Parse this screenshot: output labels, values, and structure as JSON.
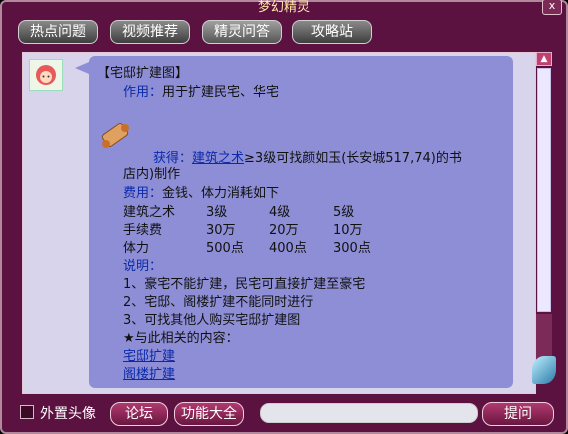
{
  "window": {
    "title": "梦幻精灵",
    "close_label": "x"
  },
  "tabs": [
    {
      "label": "热点问题"
    },
    {
      "label": "视频推荐"
    },
    {
      "label": "精灵问答"
    },
    {
      "label": "攻略站"
    }
  ],
  "answer": {
    "heading": "【宅邸扩建图】",
    "usage_label": "作用：",
    "usage_text": "用于扩建民宅、华宅",
    "obtain_label": "获得：",
    "obtain_link": "建筑之术",
    "obtain_text": "≥3级可找颜如玉(长安城517,74)的书",
    "obtain_text2": "店内)制作",
    "cost_label": "费用：",
    "cost_text": "金钱、体力消耗如下",
    "table": {
      "rows": [
        [
          "建筑之术",
          "3级",
          "4级",
          "5级"
        ],
        [
          "手续费",
          "30万",
          "20万",
          "10万"
        ],
        [
          "体力",
          "500点",
          "400点",
          "300点"
        ]
      ]
    },
    "notes_label": "说明：",
    "notes": [
      "1、豪宅不能扩建，民宅可直接扩建至豪宅",
      "2、宅邸、阁楼扩建不能同时进行",
      "3、可找其他人购买宅邸扩建图"
    ],
    "related_label": "★与此相关的内容：",
    "related_links": [
      "宅邸扩建",
      "阁楼扩建"
    ]
  },
  "footer": {
    "checkbox_label": "外置头像",
    "forum_button": "论坛",
    "features_button": "功能大全",
    "ask_button": "提问",
    "input_value": ""
  },
  "colors": {
    "window_bg": "#5c1240",
    "bubble_bg": "#8e8ed6",
    "content_bg": "#d8d4ec",
    "link": "#0a2aa8"
  },
  "icons": [
    "close-icon",
    "avatar-icon",
    "scroll-item-icon",
    "scroll-up-icon",
    "corner-sprite-icon"
  ]
}
